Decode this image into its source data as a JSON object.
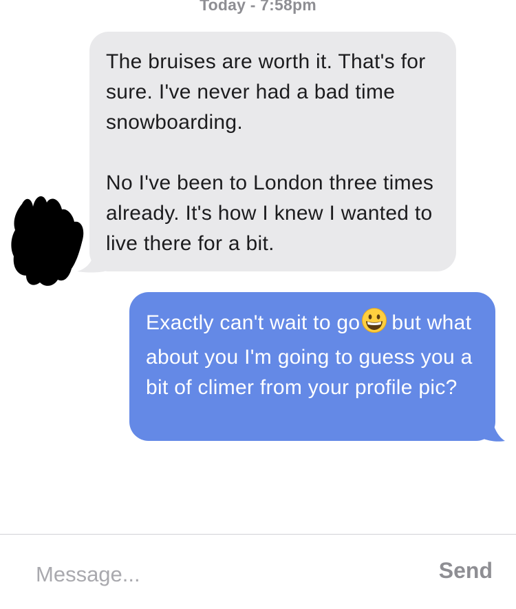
{
  "conversation": {
    "timestamp": "Today - 7:58pm",
    "messages": [
      {
        "direction": "incoming",
        "paragraphs": [
          "The bruises are worth it. That's for sure. I've never had a bad time snowboarding.",
          "No I've been to London three times already. It's how I knew I wanted to live there for a bit."
        ]
      },
      {
        "direction": "outgoing",
        "text_before_emoji": "Exactly can't wait to go",
        "emoji": "grinning-face-emoji",
        "text_after_emoji": "but what about you I'm going to guess you a bit of climer from your profile pic?"
      }
    ]
  },
  "composer": {
    "placeholder": "Message...",
    "send_label": "Send"
  },
  "colors": {
    "incoming_bubble": "#e9e9eb",
    "outgoing_bubble": "#6489e6",
    "timestamp": "#8e8e93",
    "send_button": "#8e8e93"
  }
}
